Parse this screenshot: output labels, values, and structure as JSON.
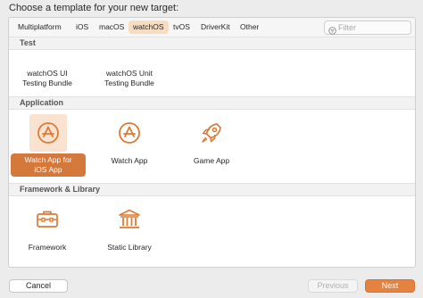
{
  "title": "Choose a template for your new target:",
  "tabs": [
    {
      "label": "Multiplatform"
    },
    {
      "label": "iOS"
    },
    {
      "label": "macOS"
    },
    {
      "label": "watchOS",
      "active": true
    },
    {
      "label": "tvOS"
    },
    {
      "label": "DriverKit"
    },
    {
      "label": "Other"
    }
  ],
  "filter": {
    "placeholder": "Filter"
  },
  "sections": {
    "test": {
      "title": "Test",
      "items": [
        {
          "label_line1": "watchOS UI",
          "label_line2": "Testing Bundle"
        },
        {
          "label_line1": "watchOS Unit",
          "label_line2": "Testing Bundle"
        }
      ]
    },
    "application": {
      "title": "Application",
      "items": [
        {
          "label_line1": "Watch App for",
          "label_line2": "iOS App",
          "icon": "app-store-icon",
          "selected": true
        },
        {
          "label_line1": "Watch App",
          "icon": "app-store-icon"
        },
        {
          "label_line1": "Game App",
          "icon": "rocket-icon"
        }
      ]
    },
    "framework": {
      "title": "Framework & Library",
      "items": [
        {
          "label_line1": "Framework",
          "icon": "toolbox-icon"
        },
        {
          "label_line1": "Static Library",
          "icon": "library-columns-icon"
        }
      ]
    }
  },
  "buttons": {
    "cancel": "Cancel",
    "previous": "Previous",
    "next": "Next"
  },
  "colors": {
    "accent": "#e5823f",
    "selected_tile_bg": "#f9e3d0",
    "active_tab_bg": "#f8dcc0",
    "icon_orange": "#dd7a34"
  }
}
